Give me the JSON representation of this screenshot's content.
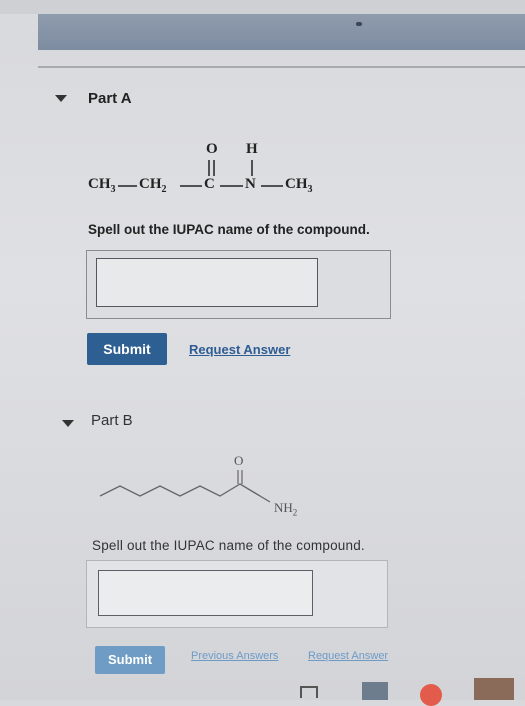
{
  "part_a": {
    "title": "Part A",
    "formula": {
      "o": "O",
      "h": "H",
      "ch3_left": "CH",
      "sub3": "3",
      "ch2": "CH",
      "sub2": "2",
      "c": "C",
      "n": "N",
      "ch3_right": "CH",
      "sub3b": "3"
    },
    "prompt": "Spell out the IUPAC name of the compound.",
    "answer_value": "",
    "submit_label": "Submit",
    "request_label": "Request Answer"
  },
  "part_b": {
    "title": "Part B",
    "structure": {
      "o": "O",
      "nh": "NH",
      "sub2": "2"
    },
    "prompt": "Spell out the IUPAC name of the compound.",
    "answer_value": "",
    "submit_label": "Submit",
    "previous_label": "Previous Answers",
    "request_label": "Request Answer"
  },
  "colors": {
    "submit_a": "#2e5f92",
    "submit_b": "#6f9cc4",
    "link_a": "#2e5c93",
    "link_b": "#6e9ac6"
  }
}
